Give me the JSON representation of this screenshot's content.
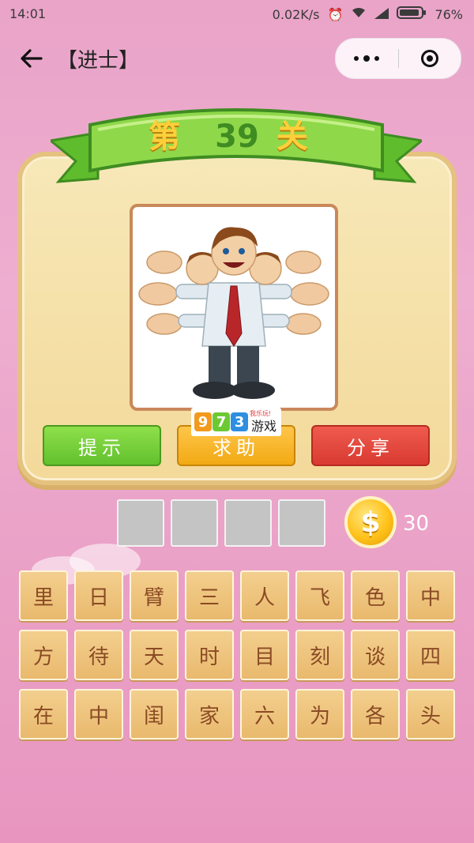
{
  "status_bar": {
    "time": "14:01",
    "speed": "0.02K/s",
    "battery": "76%"
  },
  "nav": {
    "title": "【进士】"
  },
  "level": {
    "prefix": "第",
    "number": "39",
    "suffix": "关"
  },
  "buttons": {
    "hint": "提示",
    "help": "求助",
    "share": "分享"
  },
  "watermark": {
    "d1": "9",
    "d2": "7",
    "d3": "3",
    "text": "游戏",
    "slogan": "我乐玩!"
  },
  "coins": {
    "count": "30"
  },
  "answer_slots": [
    "",
    "",
    "",
    ""
  ],
  "characters": [
    "里",
    "日",
    "臂",
    "三",
    "人",
    "飞",
    "色",
    "中",
    "方",
    "待",
    "天",
    "时",
    "目",
    "刻",
    "谈",
    "四",
    "在",
    "中",
    "闺",
    "家",
    "六",
    "为",
    "各",
    "头"
  ],
  "colors": {
    "hint": "#6cc934",
    "help": "#f5b320",
    "share": "#e2453a",
    "accent": "#3f8c22"
  }
}
